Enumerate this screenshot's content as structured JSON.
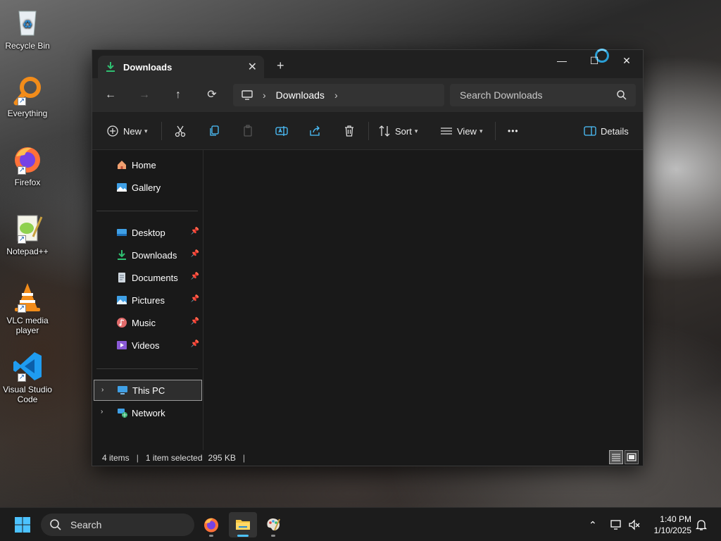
{
  "desktop": {
    "icons": [
      {
        "label": "Recycle Bin"
      },
      {
        "label": "Everything"
      },
      {
        "label": "Firefox"
      },
      {
        "label": "Notepad++"
      },
      {
        "label": "VLC media player"
      },
      {
        "label": "Visual Studio Code"
      }
    ]
  },
  "window": {
    "tab_title": "Downloads",
    "breadcrumb": [
      "Downloads"
    ],
    "search_placeholder": "Search Downloads",
    "toolbar": {
      "new_label": "New",
      "sort_label": "Sort",
      "view_label": "View",
      "more_label": "•••",
      "details_label": "Details"
    },
    "nav": {
      "home": "Home",
      "gallery": "Gallery",
      "pinned": [
        {
          "label": "Desktop"
        },
        {
          "label": "Downloads"
        },
        {
          "label": "Documents"
        },
        {
          "label": "Pictures"
        },
        {
          "label": "Music"
        },
        {
          "label": "Videos"
        }
      ],
      "this_pc": "This PC",
      "network": "Network"
    },
    "status": {
      "item_count": "4 items",
      "selection": "1 item selected",
      "size": "295 KB"
    }
  },
  "taskbar": {
    "search_label": "Search",
    "time": "1:40 PM",
    "date": "1/10/2025"
  },
  "colors": {
    "accent": "#4cc2ff",
    "window_bg": "#191919",
    "toolbar_bg": "#202020"
  }
}
